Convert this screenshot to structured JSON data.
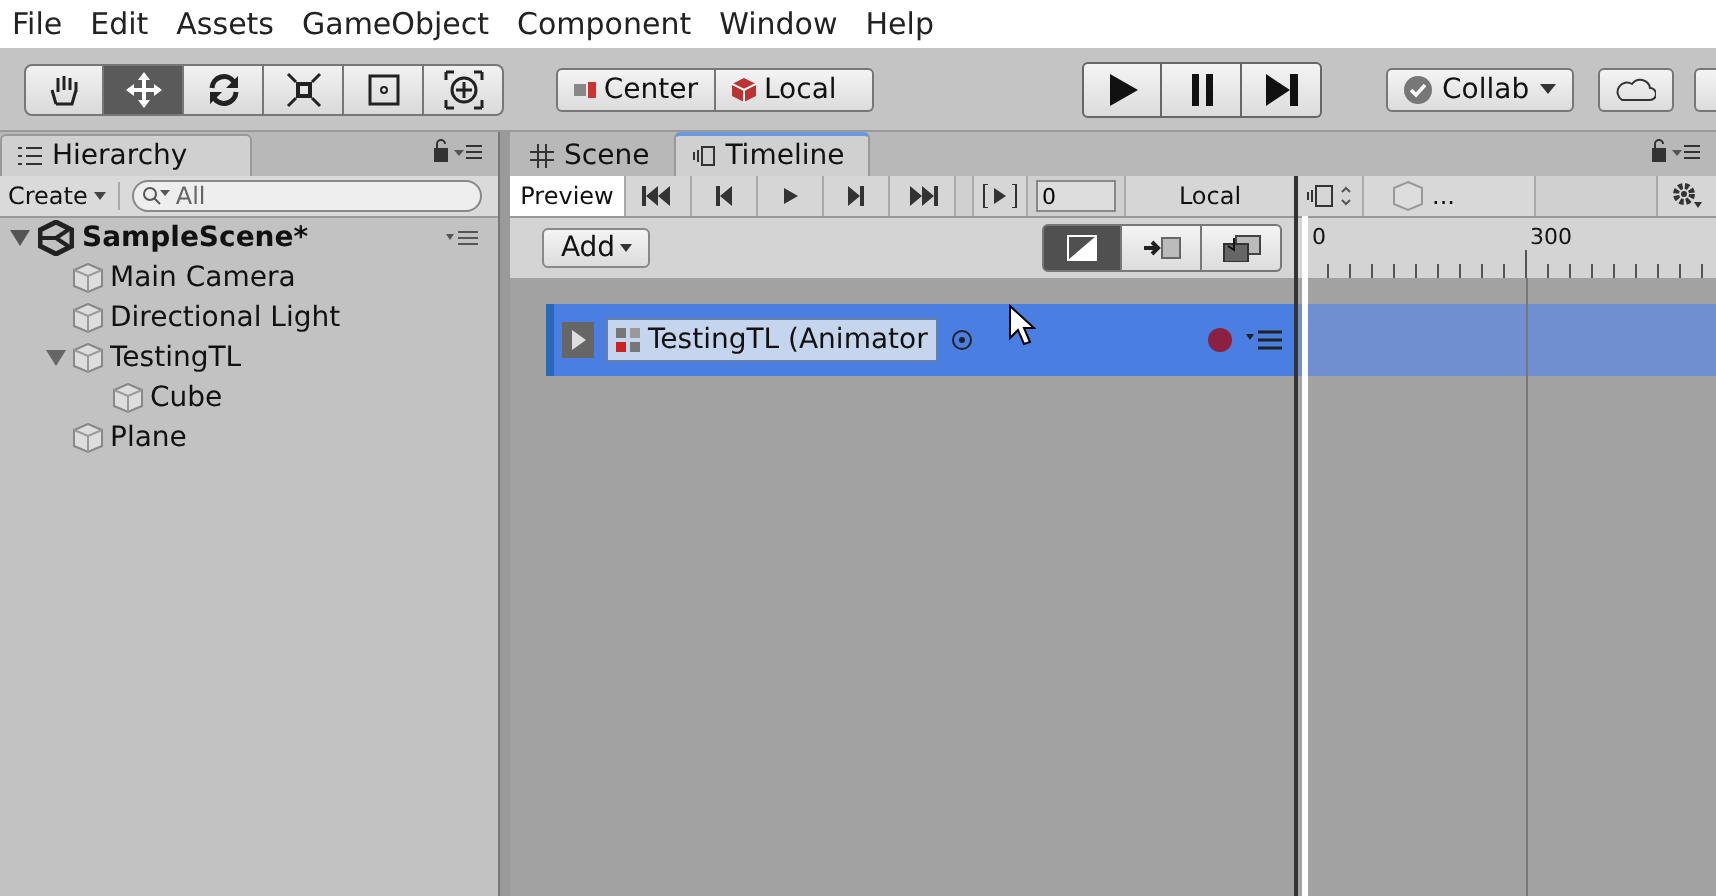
{
  "menu": [
    "File",
    "Edit",
    "Assets",
    "GameObject",
    "Component",
    "Window",
    "Help"
  ],
  "tools": [
    {
      "kind": "hand",
      "selected": false
    },
    {
      "kind": "move",
      "selected": true
    },
    {
      "kind": "rotate",
      "selected": false
    },
    {
      "kind": "scale",
      "selected": false
    },
    {
      "kind": "rect",
      "selected": false
    },
    {
      "kind": "transform",
      "selected": false
    }
  ],
  "pivot": [
    "Center",
    "Local"
  ],
  "collab": "Collab",
  "hierarchy": {
    "tab": "Hierarchy",
    "create": "Create",
    "placeholder": "All",
    "scene": "SampleScene*",
    "items": [
      {
        "name": "Main Camera"
      },
      {
        "name": "Directional Light"
      },
      {
        "name": "TestingTL",
        "expanded": true,
        "children": [
          {
            "name": "Cube"
          }
        ]
      },
      {
        "name": "Plane"
      }
    ]
  },
  "tabs": [
    {
      "label": "Scene",
      "kind": "grid",
      "selected": false
    },
    {
      "label": "Timeline",
      "kind": "timeline",
      "selected": true
    }
  ],
  "timeline": {
    "preview": "Preview",
    "frame": "0",
    "space": "Local",
    "breadcrumb": "...",
    "add": "Add",
    "modes": [
      {
        "kind": "mix",
        "selected": true
      },
      {
        "kind": "ripple",
        "selected": false
      },
      {
        "kind": "replace",
        "selected": false
      }
    ],
    "ruler": [
      "0",
      "300"
    ],
    "track": {
      "name": "TestingTL (Animator",
      "selected": true
    }
  }
}
